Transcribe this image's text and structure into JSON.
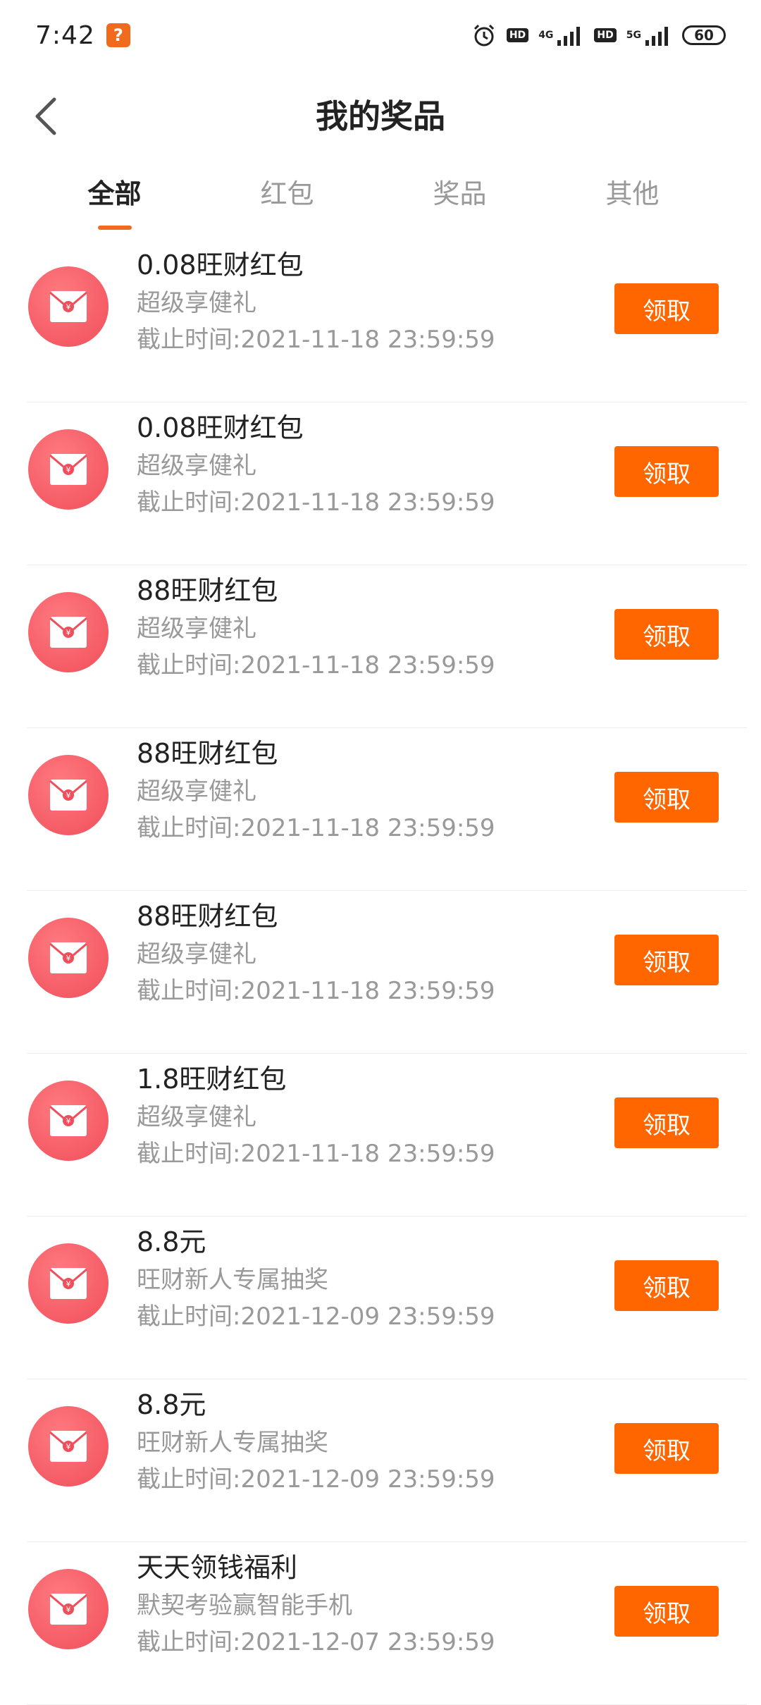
{
  "status_bar": {
    "time": "7:42",
    "app_icon_glyph": "?",
    "network_1": "4G",
    "network_2": "5G",
    "hd_label": "HD",
    "battery": "60"
  },
  "header": {
    "title": "我的奖品",
    "back_icon": "chevron-left-icon"
  },
  "tabs": [
    {
      "label": "全部",
      "active": true
    },
    {
      "label": "红包",
      "active": false
    },
    {
      "label": "奖品",
      "active": false
    },
    {
      "label": "其他",
      "active": false
    }
  ],
  "colors": {
    "accent": "#FF6600",
    "icon_red": "#F04E5A",
    "tab_indicator": "#F26B1D"
  },
  "prizes": [
    {
      "name": "0.08旺财红包",
      "source": "超级享健礼",
      "deadline": "截止时间:2021-11-18 23:59:59",
      "button": "领取"
    },
    {
      "name": "0.08旺财红包",
      "source": "超级享健礼",
      "deadline": "截止时间:2021-11-18 23:59:59",
      "button": "领取"
    },
    {
      "name": "88旺财红包",
      "source": "超级享健礼",
      "deadline": "截止时间:2021-11-18 23:59:59",
      "button": "领取"
    },
    {
      "name": "88旺财红包",
      "source": "超级享健礼",
      "deadline": "截止时间:2021-11-18 23:59:59",
      "button": "领取"
    },
    {
      "name": "88旺财红包",
      "source": "超级享健礼",
      "deadline": "截止时间:2021-11-18 23:59:59",
      "button": "领取"
    },
    {
      "name": "1.8旺财红包",
      "source": "超级享健礼",
      "deadline": "截止时间:2021-11-18 23:59:59",
      "button": "领取"
    },
    {
      "name": "8.8元",
      "source": "旺财新人专属抽奖",
      "deadline": "截止时间:2021-12-09 23:59:59",
      "button": "领取"
    },
    {
      "name": "8.8元",
      "source": "旺财新人专属抽奖",
      "deadline": "截止时间:2021-12-09 23:59:59",
      "button": "领取"
    },
    {
      "name": "天天领钱福利",
      "source": "默契考验赢智能手机",
      "deadline": "截止时间:2021-12-07 23:59:59",
      "button": "领取"
    }
  ]
}
